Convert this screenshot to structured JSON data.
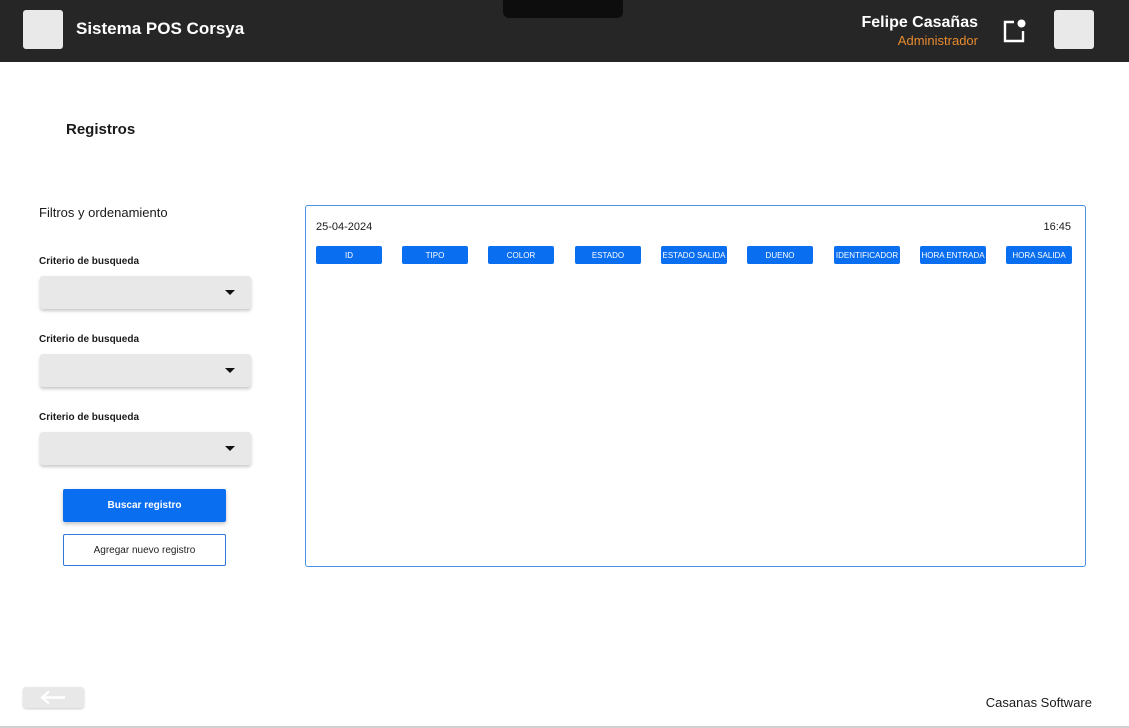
{
  "app": {
    "title": "Sistema POS Corsya"
  },
  "user": {
    "name": "Felipe Casañas",
    "role": "Administrador"
  },
  "page": {
    "title": "Registros"
  },
  "filters": {
    "title": "Filtros y ordenamiento",
    "criteria": [
      {
        "label": "Criterio de busqueda",
        "value": ""
      },
      {
        "label": "Criterio de busqueda",
        "value": ""
      },
      {
        "label": "Criterio de busqueda",
        "value": ""
      }
    ],
    "search_button": "Buscar registro",
    "add_button": "Agregar nuevo registro"
  },
  "records": {
    "date": "25-04-2024",
    "time": "16:45",
    "columns": [
      "ID",
      "TIPO",
      "COLOR",
      "ESTADO",
      "ESTADO SALIDA",
      "DUENO",
      "IDENTIFICADOR",
      "HORA ENTRADA",
      "HORA SALIDA"
    ]
  },
  "footer": {
    "text": "Casanas Software"
  },
  "icons": {
    "menu": "menu-icon",
    "notification": "notification-icon",
    "profile": "profile-icon",
    "back": "arrow-left-icon"
  },
  "colors": {
    "topbar": "#262626",
    "accent": "#0a6ef0",
    "role": "#e88a2e"
  }
}
